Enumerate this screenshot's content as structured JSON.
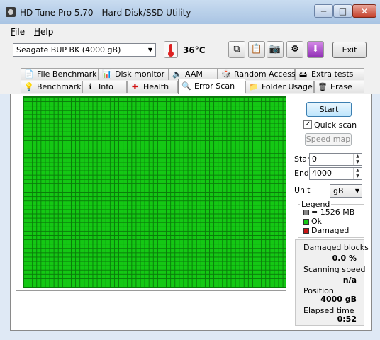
{
  "window": {
    "title": "HD Tune Pro 5.70 - Hard Disk/SSD Utility",
    "minimize": "─",
    "maximize": "□",
    "close": "✕"
  },
  "menu": {
    "file": "File",
    "help": "Help"
  },
  "toolbar": {
    "drive": "Seagate BUP BK (4000 gB)",
    "temperature": "36°C",
    "exit_label": "Exit"
  },
  "tabs": {
    "row1": [
      {
        "label": "File Benchmark",
        "icon": "📄"
      },
      {
        "label": "Disk monitor",
        "icon": "📊"
      },
      {
        "label": "AAM",
        "icon": "🔈"
      },
      {
        "label": "Random Access",
        "icon": "🎲"
      },
      {
        "label": "Extra tests",
        "icon": "🖴"
      }
    ],
    "row2": [
      {
        "label": "Benchmark",
        "icon": "💡"
      },
      {
        "label": "Info",
        "icon": "ℹ"
      },
      {
        "label": "Health",
        "icon": "✚"
      },
      {
        "label": "Error Scan",
        "icon": "🔍"
      },
      {
        "label": "Folder Usage",
        "icon": "📁"
      },
      {
        "label": "Erase",
        "icon": "🗑"
      }
    ],
    "active": "Error Scan"
  },
  "scan": {
    "start_label": "Start",
    "quick_scan_label": "Quick scan",
    "quick_scan_checked": true,
    "speed_map_label": "Speed map",
    "start_field_label": "Start",
    "start_value": "0",
    "end_field_label": "End",
    "end_value": "4000",
    "unit_label": "Unit",
    "unit_value": "gB"
  },
  "legend": {
    "title": "Legend",
    "block": "= 1526 MB",
    "ok": "Ok",
    "damaged": "Damaged"
  },
  "stats": {
    "damaged_blocks_label": "Damaged blocks",
    "damaged_blocks_value": "0.0 %",
    "scanning_speed_label": "Scanning speed",
    "scanning_speed_value": "n/a",
    "position_label": "Position",
    "position_value": "4000 gB",
    "elapsed_label": "Elapsed time",
    "elapsed_value": "0:52"
  },
  "colors": {
    "ok_block": "#14c814",
    "damaged_block": "#c81414",
    "grid_line": "#0a7a0a"
  }
}
